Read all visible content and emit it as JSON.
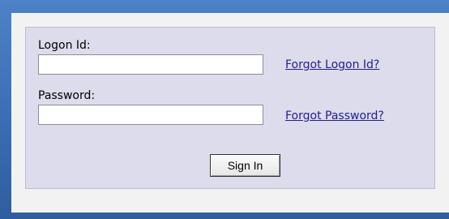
{
  "form": {
    "logon_label": "Logon Id:",
    "logon_value": "",
    "password_label": "Password:",
    "password_value": "",
    "forgot_logon_link": "Forgot Logon Id?",
    "forgot_password_link": "Forgot Password?",
    "signin_label": "Sign In"
  },
  "colors": {
    "frame_blue": "#3b6db4",
    "panel_bg": "#f2f2f2",
    "box_bg": "#dcdcec",
    "link_color": "#1f1f8f"
  }
}
